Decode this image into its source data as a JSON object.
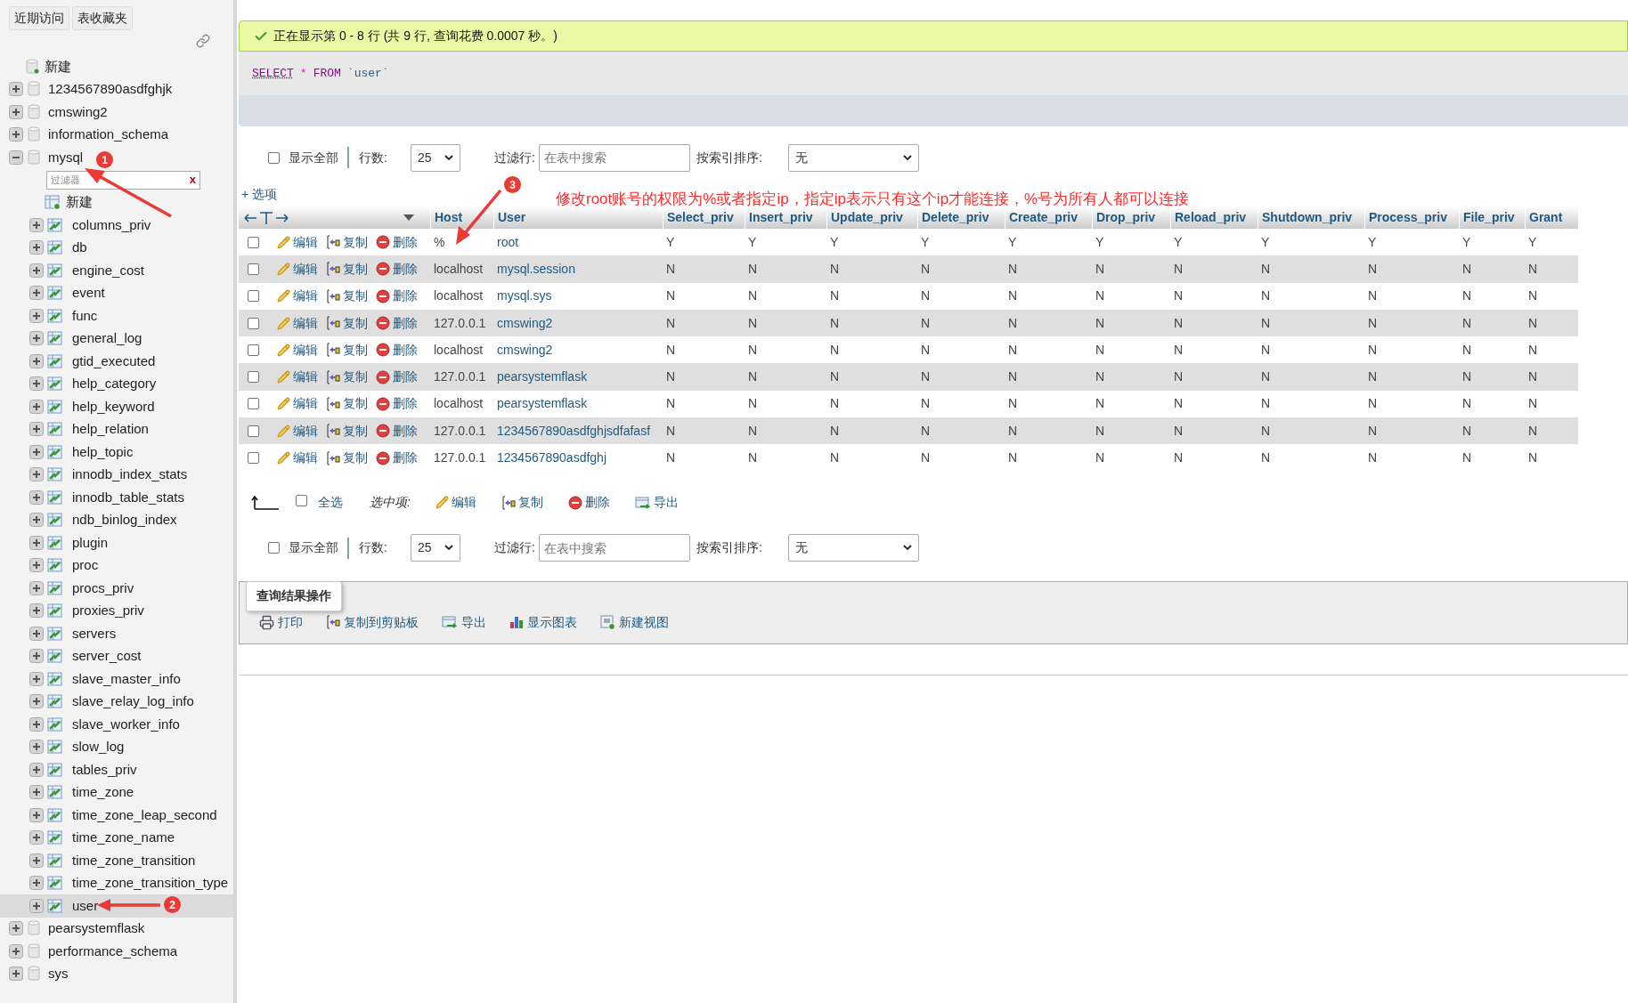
{
  "sidebar": {
    "buttons": [
      {
        "label": "近期访问"
      },
      {
        "label": "表收藏夹"
      }
    ],
    "tree": [
      {
        "kind": "new",
        "label": "新建"
      },
      {
        "kind": "db",
        "label": "1234567890asdfghjk",
        "expanded": false
      },
      {
        "kind": "db",
        "label": "cmswing2",
        "expanded": false
      },
      {
        "kind": "db",
        "label": "information_schema",
        "expanded": false
      },
      {
        "kind": "db",
        "label": "mysql",
        "expanded": true,
        "filter": {
          "placeholder": "过滤器",
          "clear": "x"
        },
        "children": [
          {
            "kind": "new",
            "label": "新建"
          },
          {
            "kind": "table",
            "label": "columns_priv",
            "selected": false
          },
          {
            "kind": "table",
            "label": "db",
            "selected": false
          },
          {
            "kind": "table",
            "label": "engine_cost",
            "selected": false
          },
          {
            "kind": "table",
            "label": "event",
            "selected": false
          },
          {
            "kind": "table",
            "label": "func",
            "selected": false
          },
          {
            "kind": "table",
            "label": "general_log",
            "selected": false
          },
          {
            "kind": "table",
            "label": "gtid_executed",
            "selected": false
          },
          {
            "kind": "table",
            "label": "help_category",
            "selected": false
          },
          {
            "kind": "table",
            "label": "help_keyword",
            "selected": false
          },
          {
            "kind": "table",
            "label": "help_relation",
            "selected": false
          },
          {
            "kind": "table",
            "label": "help_topic",
            "selected": false
          },
          {
            "kind": "table",
            "label": "innodb_index_stats",
            "selected": false
          },
          {
            "kind": "table",
            "label": "innodb_table_stats",
            "selected": false
          },
          {
            "kind": "table",
            "label": "ndb_binlog_index",
            "selected": false
          },
          {
            "kind": "table",
            "label": "plugin",
            "selected": false
          },
          {
            "kind": "table",
            "label": "proc",
            "selected": false
          },
          {
            "kind": "table",
            "label": "procs_priv",
            "selected": false
          },
          {
            "kind": "table",
            "label": "proxies_priv",
            "selected": false
          },
          {
            "kind": "table",
            "label": "servers",
            "selected": false
          },
          {
            "kind": "table",
            "label": "server_cost",
            "selected": false
          },
          {
            "kind": "table",
            "label": "slave_master_info",
            "selected": false
          },
          {
            "kind": "table",
            "label": "slave_relay_log_info",
            "selected": false
          },
          {
            "kind": "table",
            "label": "slave_worker_info",
            "selected": false
          },
          {
            "kind": "table",
            "label": "slow_log",
            "selected": false
          },
          {
            "kind": "table",
            "label": "tables_priv",
            "selected": false
          },
          {
            "kind": "table",
            "label": "time_zone",
            "selected": false
          },
          {
            "kind": "table",
            "label": "time_zone_leap_second",
            "selected": false
          },
          {
            "kind": "table",
            "label": "time_zone_name",
            "selected": false
          },
          {
            "kind": "table",
            "label": "time_zone_transition",
            "selected": false
          },
          {
            "kind": "table",
            "label": "time_zone_transition_type",
            "selected": false
          },
          {
            "kind": "table",
            "label": "user",
            "selected": true
          }
        ]
      },
      {
        "kind": "db",
        "label": "pearsystemflask",
        "expanded": false
      },
      {
        "kind": "db",
        "label": "performance_schema",
        "expanded": false
      },
      {
        "kind": "db",
        "label": "sys",
        "expanded": false
      }
    ]
  },
  "status": "正在显示第 0 - 8 行 (共 9 行, 查询花费 0.0007 秒。)",
  "sql": [
    {
      "kind": "keyword",
      "text": "SELECT"
    },
    {
      "kind": "operator",
      "text": "*"
    },
    {
      "kind": "plain",
      "text": "FROM"
    },
    {
      "kind": "identifier",
      "text": "`user`"
    }
  ],
  "nav_bars": [
    {
      "show_all": {
        "label": "显示全部",
        "checked": false
      },
      "rows_label": "行数:",
      "rows_value": "25",
      "filter_label": "过滤行:",
      "filter_placeholder": "在表中搜索",
      "sort_label": "按索引排序:",
      "sort_value": "无"
    },
    {
      "show_all": {
        "label": "显示全部",
        "checked": false
      },
      "rows_label": "行数:",
      "rows_value": "25",
      "filter_label": "过滤行:",
      "filter_placeholder": "在表中搜索",
      "sort_label": "按索引排序:",
      "sort_value": "无"
    }
  ],
  "options_link": "+ 选项",
  "table": {
    "columns": [
      "Host",
      "User",
      "Select_priv",
      "Insert_priv",
      "Update_priv",
      "Delete_priv",
      "Create_priv",
      "Drop_priv",
      "Reload_priv",
      "Shutdown_priv",
      "Process_priv",
      "File_priv",
      "Grant"
    ],
    "rows": [
      {
        "checked": false,
        "actions": [
          "编辑",
          "复制",
          "删除"
        ],
        "cells": [
          "%",
          "root",
          "Y",
          "Y",
          "Y",
          "Y",
          "Y",
          "Y",
          "Y",
          "Y",
          "Y",
          "Y",
          "Y"
        ]
      },
      {
        "checked": false,
        "actions": [
          "编辑",
          "复制",
          "删除"
        ],
        "cells": [
          "localhost",
          "mysql.session",
          "N",
          "N",
          "N",
          "N",
          "N",
          "N",
          "N",
          "N",
          "N",
          "N",
          "N"
        ]
      },
      {
        "checked": false,
        "actions": [
          "编辑",
          "复制",
          "删除"
        ],
        "cells": [
          "localhost",
          "mysql.sys",
          "N",
          "N",
          "N",
          "N",
          "N",
          "N",
          "N",
          "N",
          "N",
          "N",
          "N"
        ]
      },
      {
        "checked": false,
        "actions": [
          "编辑",
          "复制",
          "删除"
        ],
        "cells": [
          "127.0.0.1",
          "cmswing2",
          "N",
          "N",
          "N",
          "N",
          "N",
          "N",
          "N",
          "N",
          "N",
          "N",
          "N"
        ]
      },
      {
        "checked": false,
        "actions": [
          "编辑",
          "复制",
          "删除"
        ],
        "cells": [
          "localhost",
          "cmswing2",
          "N",
          "N",
          "N",
          "N",
          "N",
          "N",
          "N",
          "N",
          "N",
          "N",
          "N"
        ]
      },
      {
        "checked": false,
        "actions": [
          "编辑",
          "复制",
          "删除"
        ],
        "cells": [
          "127.0.0.1",
          "pearsystemflask",
          "N",
          "N",
          "N",
          "N",
          "N",
          "N",
          "N",
          "N",
          "N",
          "N",
          "N"
        ]
      },
      {
        "checked": false,
        "actions": [
          "编辑",
          "复制",
          "删除"
        ],
        "cells": [
          "localhost",
          "pearsystemflask",
          "N",
          "N",
          "N",
          "N",
          "N",
          "N",
          "N",
          "N",
          "N",
          "N",
          "N"
        ]
      },
      {
        "checked": false,
        "actions": [
          "编辑",
          "复制",
          "删除"
        ],
        "cells": [
          "127.0.0.1",
          "1234567890asdfghjsdfafasf",
          "N",
          "N",
          "N",
          "N",
          "N",
          "N",
          "N",
          "N",
          "N",
          "N",
          "N"
        ]
      },
      {
        "checked": false,
        "actions": [
          "编辑",
          "复制",
          "删除"
        ],
        "cells": [
          "127.0.0.1",
          "1234567890asdfghj",
          "N",
          "N",
          "N",
          "N",
          "N",
          "N",
          "N",
          "N",
          "N",
          "N",
          "N"
        ]
      }
    ]
  },
  "bulk": {
    "select_all": {
      "label": "全选",
      "checked": false
    },
    "with_selected": "选中项:",
    "actions": [
      {
        "kind": "edit",
        "label": "编辑"
      },
      {
        "kind": "copy",
        "label": "复制"
      },
      {
        "kind": "delete",
        "label": "删除"
      },
      {
        "kind": "export",
        "label": "导出"
      }
    ]
  },
  "query_ops": {
    "legend": "查询结果操作",
    "items": [
      {
        "kind": "print",
        "label": "打印"
      },
      {
        "kind": "copy",
        "label": "复制到剪贴板"
      },
      {
        "kind": "export",
        "label": "导出"
      },
      {
        "kind": "chart",
        "label": "显示图表"
      },
      {
        "kind": "view",
        "label": "新建视图"
      }
    ]
  },
  "annotations": {
    "badges": [
      "1",
      "2",
      "3"
    ],
    "note": "修改root账号的权限为%或者指定ip，指定ip表示只有这个ip才能连接，%号为所有人都可以连接"
  }
}
